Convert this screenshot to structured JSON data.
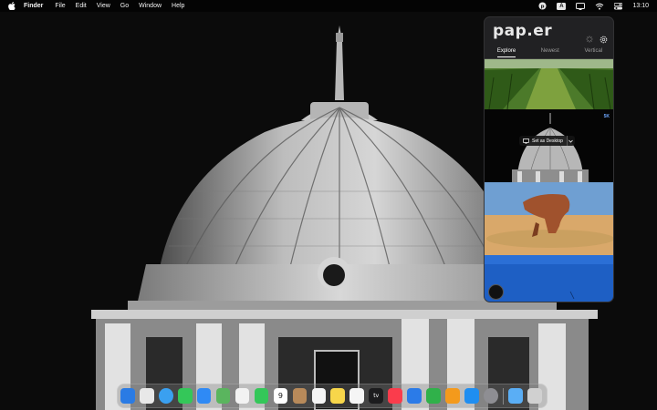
{
  "menubar": {
    "app_name": "Finder",
    "menus": [
      "File",
      "Edit",
      "View",
      "Go",
      "Window",
      "Help"
    ],
    "clock": "13:10",
    "status_icons": [
      "paper-icon",
      "input-source-icon",
      "display-icon",
      "wifi-icon",
      "control-center-icon"
    ],
    "input_source_label": "A"
  },
  "popover": {
    "logo": "pap.er",
    "tabs": [
      {
        "label": "Explore",
        "active": true
      },
      {
        "label": "Newest",
        "active": false
      },
      {
        "label": "Vertical",
        "active": false
      }
    ],
    "thumbnails": [
      {
        "subject": "vineyard"
      },
      {
        "subject": "dome",
        "badge": "5K",
        "action_label": "Set as Desktop"
      },
      {
        "subject": "desert-rock"
      },
      {
        "subject": "blue-sea"
      }
    ]
  },
  "dock": {
    "apps": [
      {
        "name": "finder-icon",
        "color": "#2a7be4"
      },
      {
        "name": "launchpad-icon",
        "color": "#e8e8e8"
      },
      {
        "name": "safari-icon",
        "color": "#3aa0f0"
      },
      {
        "name": "messages-icon",
        "color": "#34c759"
      },
      {
        "name": "mail-icon",
        "color": "#2f8af5"
      },
      {
        "name": "maps-icon",
        "color": "#5ab55e"
      },
      {
        "name": "photos-icon",
        "color": "#f2f2f2"
      },
      {
        "name": "facetime-icon",
        "color": "#34c759"
      },
      {
        "name": "calendar-icon",
        "color": "#ffffff",
        "label": "9"
      },
      {
        "name": "contacts-icon",
        "color": "#b88a5a"
      },
      {
        "name": "reminders-icon",
        "color": "#f5f5f5"
      },
      {
        "name": "notes-icon",
        "color": "#f7d64a"
      },
      {
        "name": "freeform-icon",
        "color": "#f5f5f5"
      },
      {
        "name": "tv-icon",
        "color": "#1c1c1e",
        "label": "tv"
      },
      {
        "name": "music-icon",
        "color": "#fa3c4c"
      },
      {
        "name": "keynote-icon",
        "color": "#2b7be8"
      },
      {
        "name": "numbers-icon",
        "color": "#30b14a"
      },
      {
        "name": "pages-icon",
        "color": "#f49a1c"
      },
      {
        "name": "app-store-icon",
        "color": "#1f8ef1"
      },
      {
        "name": "system-settings-icon",
        "color": "#8e8e93"
      },
      {
        "name": "downloads-folder-icon",
        "color": "#5aaef5"
      },
      {
        "name": "trash-icon",
        "color": "#d0d0d0"
      }
    ]
  }
}
